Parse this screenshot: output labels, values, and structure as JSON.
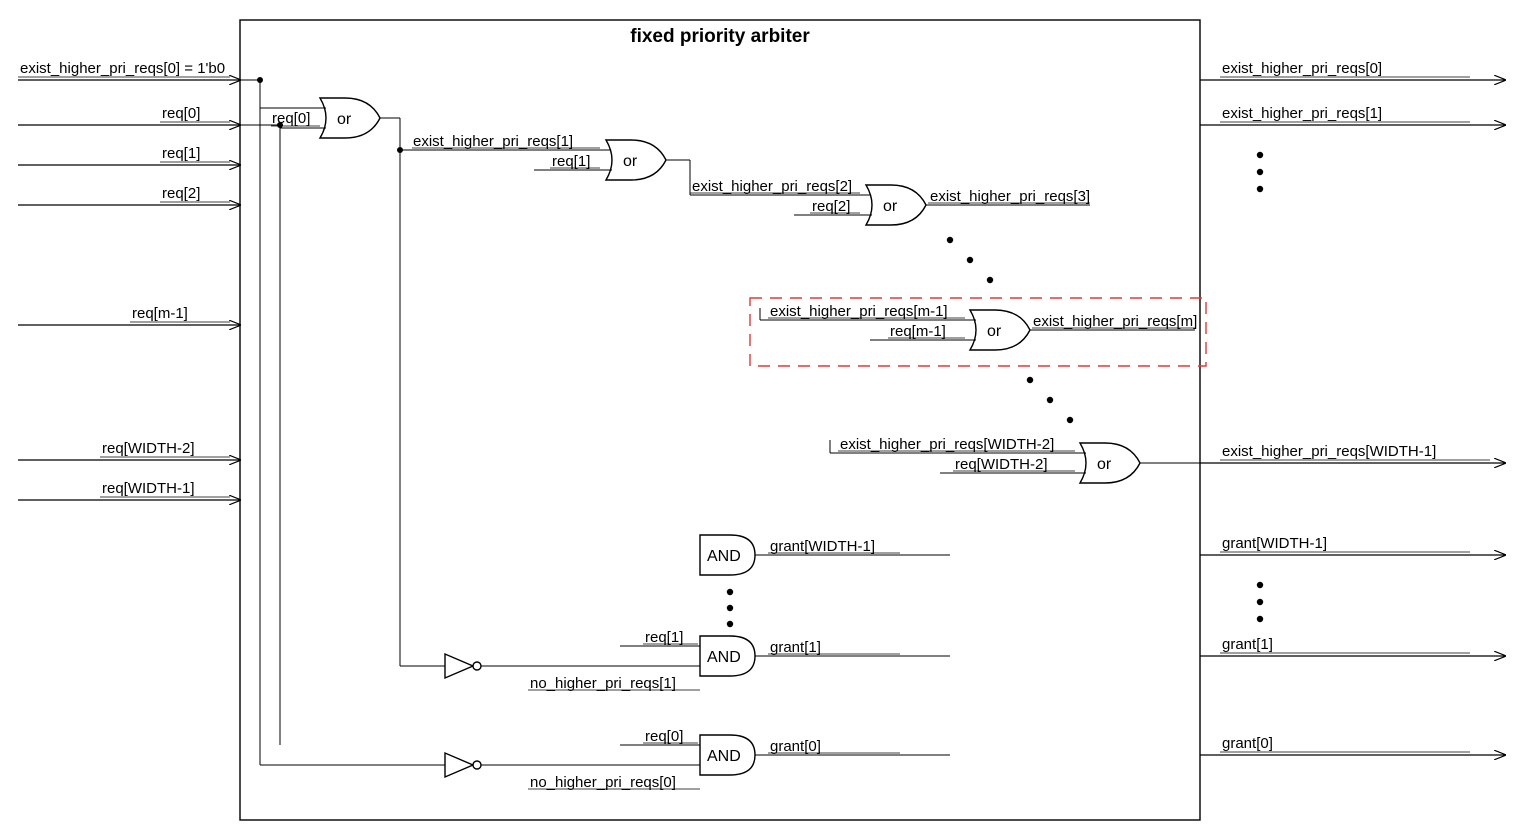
{
  "title": "fixed priority arbiter",
  "inputs": {
    "ehpr0": "exist_higher_pri_reqs[0] = 1'b0",
    "req0": "req[0]",
    "req1": "req[1]",
    "req2": "req[2]",
    "reqm1": "req[m-1]",
    "reqW2": "req[WIDTH-2]",
    "reqW1": "req[WIDTH-1]"
  },
  "internal": {
    "ehpr1": "exist_higher_pri_reqs[1]",
    "ehpr2": "exist_higher_pri_reqs[2]",
    "ehpr3": "exist_higher_pri_reqs[3]",
    "ehprm1": "exist_higher_pri_reqs[m-1]",
    "ehprm": "exist_higher_pri_reqs[m]",
    "ehprW2": "exist_higher_pri_reqs[WIDTH-2]",
    "req0b": "req[0]",
    "req1b": "req[1]",
    "req2b": "req[2]",
    "reqm1b": "req[m-1]",
    "reqW2b": "req[WIDTH-2]",
    "grantW1": "grant[WIDTH-1]",
    "grant1": "grant[1]",
    "grant0": "grant[0]",
    "nhpr1": "no_higher_pri_reqs[1]",
    "nhpr0": "no_higher_pri_reqs[0]",
    "req1c": "req[1]",
    "req0c": "req[0]"
  },
  "outputs": {
    "ehpr0o": "exist_higher_pri_reqs[0]",
    "ehpr1o": "exist_higher_pri_reqs[1]",
    "ehprW1": "exist_higher_pri_reqs[WIDTH-1]",
    "grantW1o": "grant[WIDTH-1]",
    "grant1o": "grant[1]",
    "grant0o": "grant[0]"
  },
  "gates": {
    "or": "or",
    "and": "AND"
  }
}
